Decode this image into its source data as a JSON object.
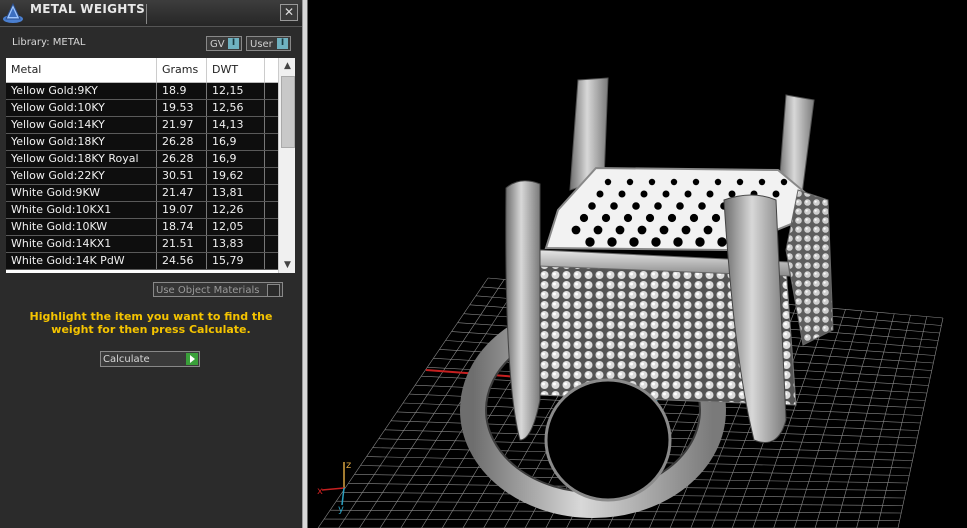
{
  "panel": {
    "title": "METAL WEIGHTS",
    "close_glyph": "✕",
    "library_label": "Library: METAL",
    "toggles": [
      {
        "label": "GV",
        "checked": true
      },
      {
        "label": "User",
        "checked": true
      }
    ],
    "toggle_tick": "I",
    "table": {
      "columns": [
        "Metal",
        "Grams",
        "DWT"
      ],
      "rows": [
        [
          "Yellow Gold:9KY",
          "18.9",
          "12,15"
        ],
        [
          "Yellow Gold:10KY",
          "19.53",
          "12,56"
        ],
        [
          "Yellow Gold:14KY",
          "21.97",
          "14,13"
        ],
        [
          "Yellow Gold:18KY",
          "26.28",
          "16,9"
        ],
        [
          "Yellow Gold:18KY Royal",
          "26.28",
          "16,9"
        ],
        [
          "Yellow Gold:22KY",
          "30.51",
          "19,62"
        ],
        [
          "White Gold:9KW",
          "21.47",
          "13,81"
        ],
        [
          "White Gold:10KX1",
          "19.07",
          "12,26"
        ],
        [
          "White Gold:10KW",
          "18.74",
          "12,05"
        ],
        [
          "White Gold:14KX1",
          "21.51",
          "13,83"
        ],
        [
          "White Gold:14K PdW",
          "24.56",
          "15,79"
        ]
      ]
    },
    "use_object_materials": "Use Object Materials",
    "hint": "Highlight the item you want to find the weight for then press Calculate.",
    "calculate_label": "Calculate"
  },
  "viewport": {
    "axis_labels": {
      "x": "x",
      "y": "y",
      "z": "z"
    }
  },
  "colors": {
    "hint": "#f5c400",
    "grid": "#8a8a8a",
    "x_axis": "#c62020",
    "y_axis": "#2a9fbf",
    "calculate_arrow": "#3aa03a"
  }
}
